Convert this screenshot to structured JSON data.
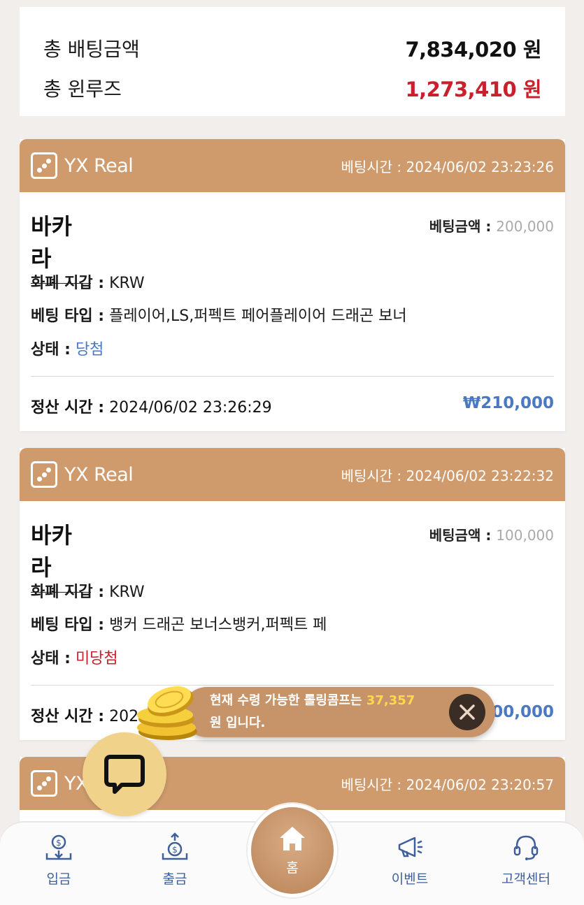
{
  "summary": {
    "total_bet_label": "총 배팅금액",
    "total_bet_value": "7,834,020 원",
    "total_winloss_label": "총 윈루즈",
    "total_winloss_value": "1,273,410 원"
  },
  "cards": [
    {
      "provider": "YX Real",
      "bet_time_label": "베팅시간 :",
      "bet_time": "2024/06/02 23:23:26",
      "game": "바카라",
      "bet_amount_label": "베팅금액 :",
      "bet_amount": "200,000",
      "wallet_label": "화폐 지갑 :",
      "wallet": "KRW",
      "bet_type_label": "베팅 타입 :",
      "bet_type": "플레이어,LS,퍼펙트 페어플레이어 드래곤 보너",
      "status_label": "상태 :",
      "status": "당첨",
      "settle_label": "정산 시간 :",
      "settle_time": "2024/06/02 23:26:29",
      "payout": "₩210,000"
    },
    {
      "provider": "YX Real",
      "bet_time_label": "베팅시간 :",
      "bet_time": "2024/06/02 23:22:32",
      "game": "바카라",
      "bet_amount_label": "베팅금액 :",
      "bet_amount": "100,000",
      "wallet_label": "화폐 지갑 :",
      "wallet": "KRW",
      "bet_type_label": "베팅 타입 :",
      "bet_type": "뱅커 드래곤 보너스뱅커,퍼펙트 페",
      "status_label": "상태 :",
      "status": "미당첨",
      "settle_label": "정산 시간 :",
      "settle_time": "202",
      "payout": "100,000"
    },
    {
      "provider": "YX",
      "bet_time_label": "베팅시간 :",
      "bet_time": "2024/06/02 23:20:57"
    }
  ],
  "toast": {
    "line1_prefix": "현재 수령 가능한 롤링콤프는 ",
    "amount": "37,357",
    "line2": "원 입니다."
  },
  "nav": {
    "deposit": "입금",
    "withdraw": "출금",
    "home": "홈",
    "event": "이벤트",
    "support": "고객센터"
  },
  "colors": {
    "accent": "#cf9b6d",
    "win": "#4a78c2",
    "lose": "#c8202c",
    "nav_icon": "#3f5f9a"
  }
}
